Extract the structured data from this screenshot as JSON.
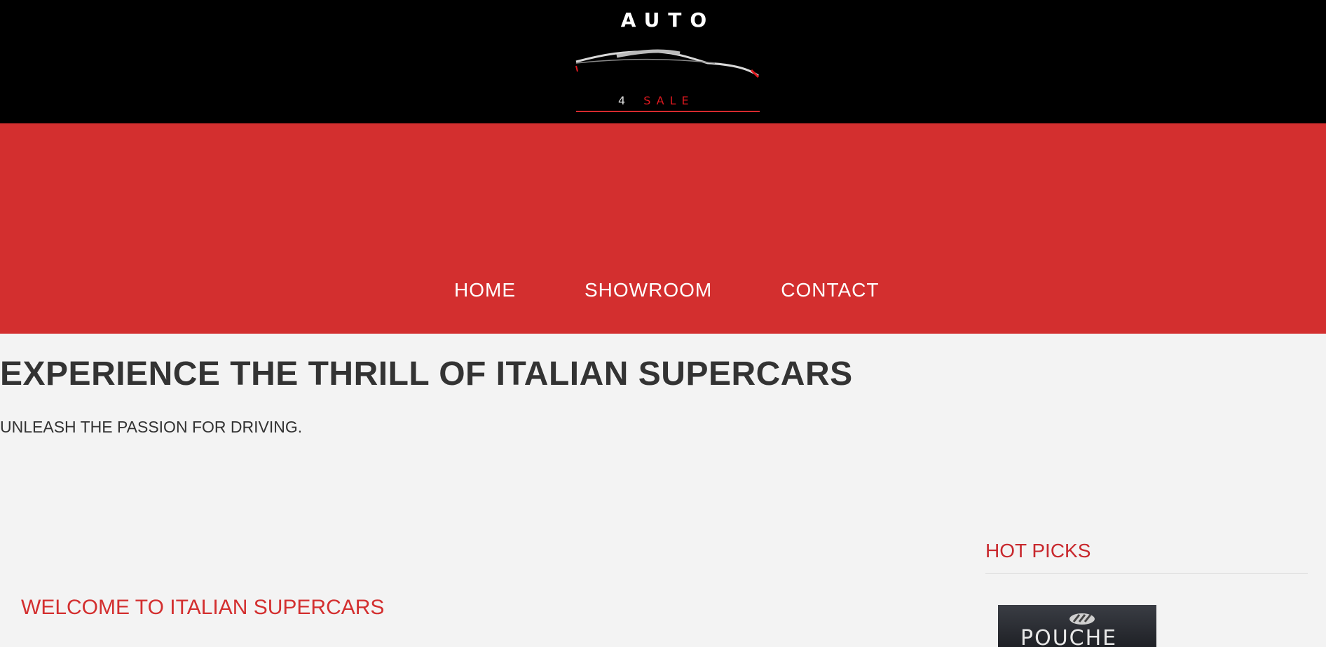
{
  "logo": {
    "top_text": "AUTO",
    "number": "4",
    "word": "SALE"
  },
  "nav": {
    "items": [
      {
        "label": "HOME"
      },
      {
        "label": "SHOWROOM"
      },
      {
        "label": "CONTACT"
      }
    ]
  },
  "hero": {
    "title": "EXPERIENCE THE THRILL OF ITALIAN SUPERCARS",
    "subtitle": "UNLEASH THE PASSION FOR DRIVING."
  },
  "main": {
    "welcome_heading": "WELCOME TO ITALIAN SUPERCARS"
  },
  "sidebar": {
    "heading": "HOT PICKS",
    "thumbnail_brand": "POUCHE"
  },
  "colors": {
    "accent_red": "#d32f2f",
    "header_black": "#000000",
    "page_bg": "#f3f3f3"
  }
}
